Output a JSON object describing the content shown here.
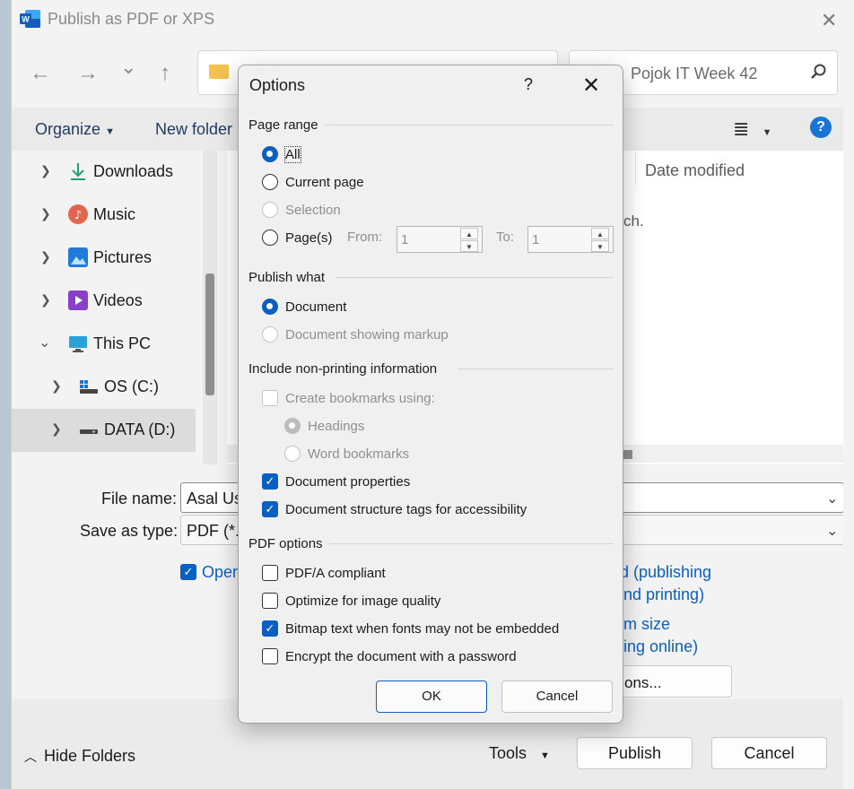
{
  "window": {
    "title": "Publish as PDF or XPS",
    "close_glyph": "✕",
    "word_icon_label": "W"
  },
  "nav": {
    "back_glyph": "←",
    "forward_glyph": "→",
    "recent_glyph": "⌄",
    "up_glyph": "↑",
    "search_text": "Pojok IT Week 42",
    "search_icon_glyph": "⚲"
  },
  "toolbar": {
    "organize": "Organize",
    "new_folder": "New folder",
    "view_glyph": "≣",
    "help_glyph": "?"
  },
  "sidebar": {
    "items": [
      {
        "label": "Downloads",
        "icon": "downloads-icon"
      },
      {
        "label": "Music",
        "icon": "music-icon"
      },
      {
        "label": "Pictures",
        "icon": "pictures-icon"
      },
      {
        "label": "Videos",
        "icon": "videos-icon"
      },
      {
        "label": "This PC",
        "icon": "this-pc-icon"
      },
      {
        "label": "OS (C:)",
        "icon": "drive-icon"
      },
      {
        "label": "DATA (D:)",
        "icon": "drive-icon"
      }
    ]
  },
  "filepane": {
    "column_date": "Date modified",
    "fragment": "ch."
  },
  "form": {
    "file_name_label": "File name:",
    "file_name_value": "Asal Us",
    "save_type_label": "Save as type:",
    "save_type_value": "PDF (*.p",
    "open_label": "Open",
    "opt_line1": "rd (publishing",
    "opt_line2": "and printing)",
    "opt_line3": "um size",
    "opt_line4": "hing online)",
    "options_button": "ons..."
  },
  "footer": {
    "hide_folders": "Hide Folders",
    "tools": "Tools",
    "publish": "Publish",
    "cancel": "Cancel"
  },
  "dialog": {
    "title": "Options",
    "help": "?",
    "close": "✕",
    "page_range": {
      "heading": "Page range",
      "all": "All",
      "current_page": "Current page",
      "selection": "Selection",
      "pages": "Page(s)",
      "from_label": "From:",
      "from_value": "1",
      "to_label": "To:",
      "to_value": "1"
    },
    "publish_what": {
      "heading": "Publish what",
      "document": "Document",
      "document_markup": "Document showing markup"
    },
    "non_printing": {
      "heading": "Include non-printing information",
      "create_bookmarks": "Create bookmarks using:",
      "headings": "Headings",
      "word_bookmarks": "Word bookmarks",
      "doc_properties": "Document properties",
      "structure_tags": "Document structure tags for accessibility"
    },
    "pdf_options": {
      "heading": "PDF options",
      "pdfa": "PDF/A compliant",
      "optimize": "Optimize for image quality",
      "bitmap_text": "Bitmap text when fonts may not be embedded",
      "encrypt": "Encrypt the document with a password"
    },
    "ok": "OK",
    "cancel": "Cancel"
  },
  "colors": {
    "accent": "#0a5fc2",
    "disabled": "#8f8f8f"
  }
}
